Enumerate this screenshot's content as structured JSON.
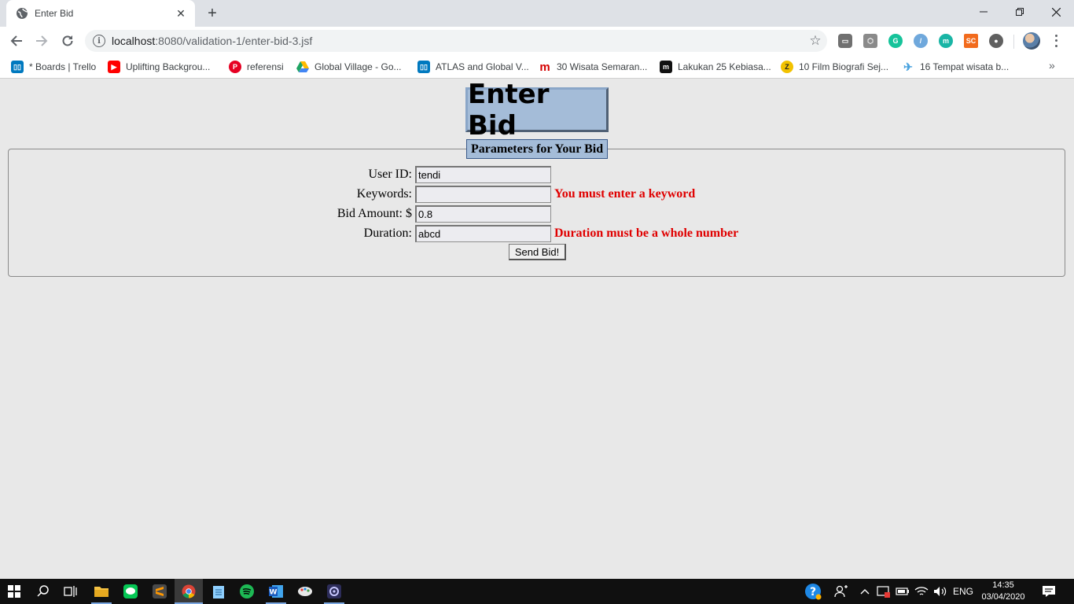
{
  "browser": {
    "tab_title": "Enter Bid",
    "url_host": "localhost",
    "url_rest": ":8080/validation-1/enter-bid-3.jsf"
  },
  "bookmarks": [
    {
      "label": "* Boards | Trello",
      "icon": "trello-icon",
      "color": "#0079bf"
    },
    {
      "label": "Uplifting Backgrou...",
      "icon": "youtube-icon",
      "color": "#ff0000"
    },
    {
      "label": "referensi",
      "icon": "pinterest-icon",
      "color": "#e60023"
    },
    {
      "label": "Global Village - Go...",
      "icon": "google-drive-icon",
      "color": "#1fa463"
    },
    {
      "label": "ATLAS and Global V...",
      "icon": "trello-icon",
      "color": "#0079bf"
    },
    {
      "label": "30 Wisata Semaran...",
      "icon": "m-red-icon",
      "color": "#d50000"
    },
    {
      "label": "Lakukan 25 Kebiasa...",
      "icon": "m-black-icon",
      "color": "#111111"
    },
    {
      "label": "10 Film Biografi Sej...",
      "icon": "z-coin-icon",
      "color": "#f2c200"
    },
    {
      "label": "16 Tempat wisata b...",
      "icon": "bird-icon",
      "color": "#4aa3df"
    }
  ],
  "page": {
    "heading": "Enter Bid",
    "legend": "Parameters for Your Bid",
    "fields": [
      {
        "label": "User ID:",
        "value": "tendi",
        "error": ""
      },
      {
        "label": "Keywords:",
        "value": "",
        "error": "You must enter a keyword"
      },
      {
        "label": "Bid Amount: $",
        "value": "0.8",
        "error": ""
      },
      {
        "label": "Duration:",
        "value": "abcd",
        "error": "Duration must be a whole number"
      }
    ],
    "submit_label": "Send Bid!"
  },
  "taskbar": {
    "language": "ENG",
    "time": "14:35",
    "date": "03/04/2020"
  },
  "colors": {
    "heading_bg": "#a4bcd8",
    "error": "#e00000",
    "page_bg": "#e8e8e8"
  }
}
